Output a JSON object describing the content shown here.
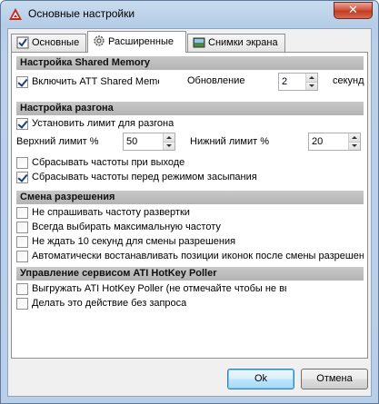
{
  "window": {
    "title": "Основные настройки",
    "close_glyph": "✕"
  },
  "tabs": [
    {
      "label": "Основные",
      "icon": "checklist-icon"
    },
    {
      "label": "Расширенные",
      "icon": "gear-icon",
      "active": true
    },
    {
      "label": "Снимки экрана",
      "icon": "screenshot-icon"
    }
  ],
  "sections": {
    "shared_memory": {
      "header": "Настройка Shared Memory",
      "enable_label": "Включить АТТ Shared Memo",
      "enable_checked": true,
      "update_label": "Обновление",
      "update_value": "2",
      "update_unit": "секунд"
    },
    "overclock": {
      "header": "Настройка разгона",
      "limit_label": "Установить лимит для разгона",
      "limit_checked": true,
      "upper_label": "Верхний лимит %",
      "upper_value": "50",
      "lower_label": "Нижний лимит %",
      "lower_value": "20",
      "reset_exit_label": "Сбрасывать частоты при выходе",
      "reset_exit_checked": false,
      "reset_sleep_label": "Сбрасывать частоты перед режимом засыпания",
      "reset_sleep_checked": true
    },
    "resolution": {
      "header": "Смена разрешения",
      "items": [
        {
          "label": "Не спрашивать частоту развертки",
          "checked": false
        },
        {
          "label": "Всегда выбирать максимальную частоту",
          "checked": false
        },
        {
          "label": "Не ждать 10 секунд для смены разрешения",
          "checked": false
        },
        {
          "label": "Автоматически востанавливать позиции иконок после смены разрешен",
          "checked": false
        }
      ]
    },
    "hotkey": {
      "header": "Управление сервисом ATI HotKey Poller",
      "items": [
        {
          "label": "Выгружать ATI HotKey Poller (не отмечайте чтобы не вь",
          "checked": false
        },
        {
          "label": "Делать это действие без запроса",
          "checked": false
        }
      ]
    }
  },
  "buttons": {
    "ok": "Ok",
    "cancel": "Отмена"
  }
}
